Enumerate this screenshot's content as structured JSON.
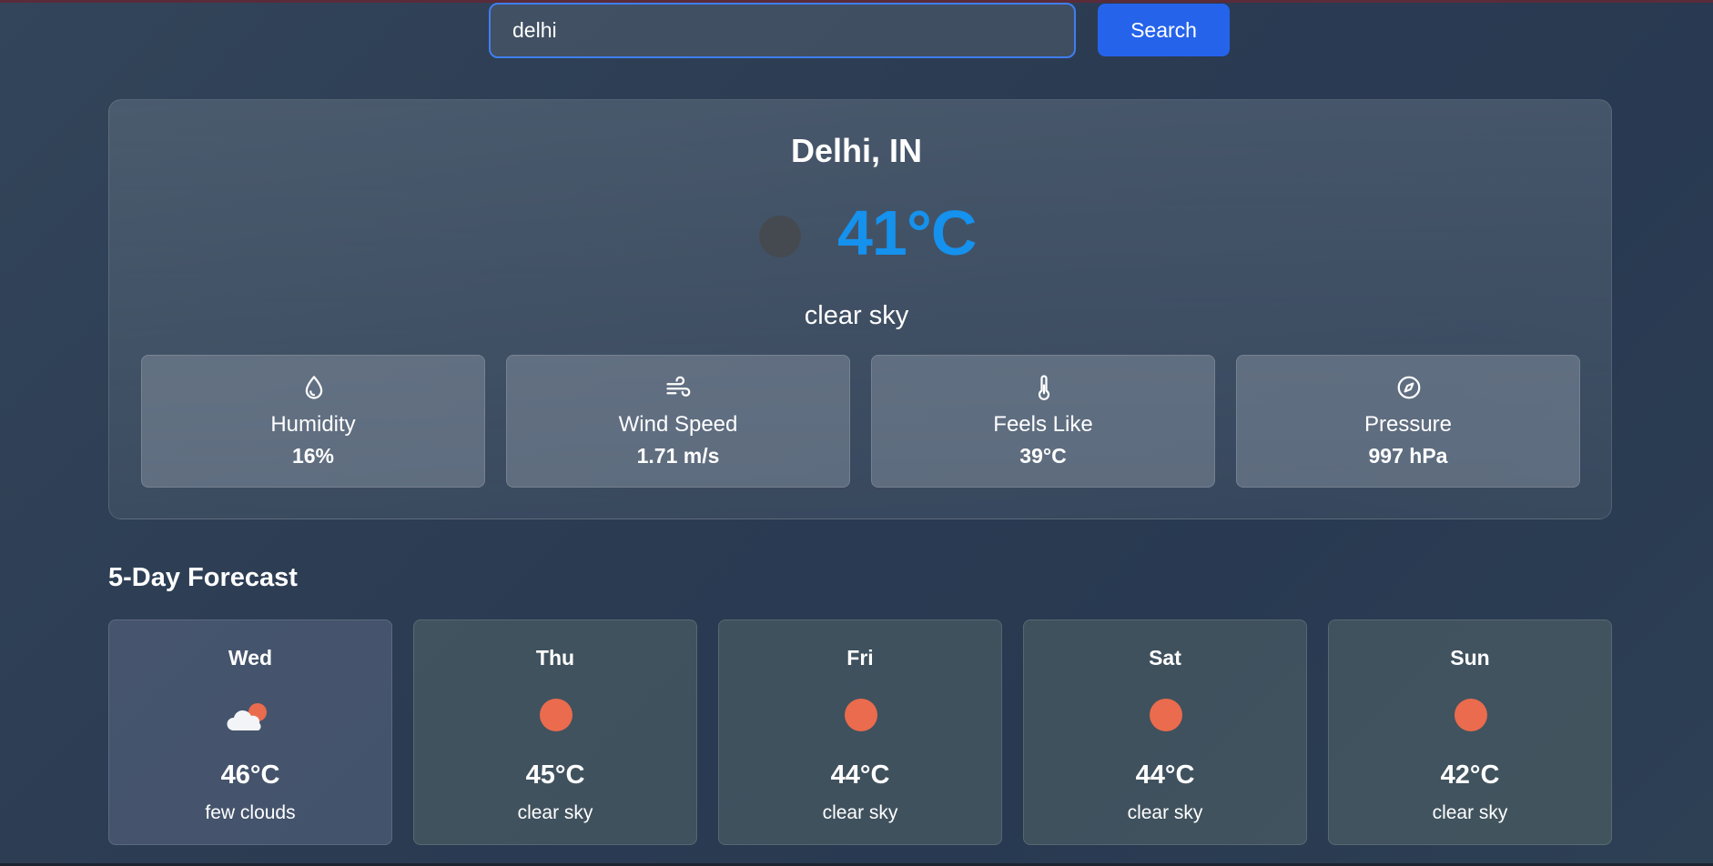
{
  "search": {
    "value": "delhi",
    "button_label": "Search"
  },
  "current": {
    "city": "Delhi, IN",
    "temperature": "41°C",
    "description": "clear sky",
    "icon": "clear-night-icon",
    "temp_color": "#1591ee"
  },
  "stats": [
    {
      "label": "Humidity",
      "value": "16%",
      "icon": "droplet-icon"
    },
    {
      "label": "Wind Speed",
      "value": "1.71 m/s",
      "icon": "wind-icon"
    },
    {
      "label": "Feels Like",
      "value": "39°C",
      "icon": "thermometer-icon"
    },
    {
      "label": "Pressure",
      "value": "997 hPa",
      "icon": "compass-icon"
    }
  ],
  "forecast": {
    "title": "5-Day Forecast",
    "days": [
      {
        "day": "Wed",
        "temp": "46°C",
        "description": "few clouds",
        "icon": "few-clouds-icon"
      },
      {
        "day": "Thu",
        "temp": "45°C",
        "description": "clear sky",
        "icon": "sun-icon"
      },
      {
        "day": "Fri",
        "temp": "44°C",
        "description": "clear sky",
        "icon": "sun-icon"
      },
      {
        "day": "Sat",
        "temp": "44°C",
        "description": "clear sky",
        "icon": "sun-icon"
      },
      {
        "day": "Sun",
        "temp": "42°C",
        "description": "clear sky",
        "icon": "sun-icon"
      }
    ]
  },
  "colors": {
    "accent": "#2563eb",
    "sun": "#ea6b4d"
  }
}
